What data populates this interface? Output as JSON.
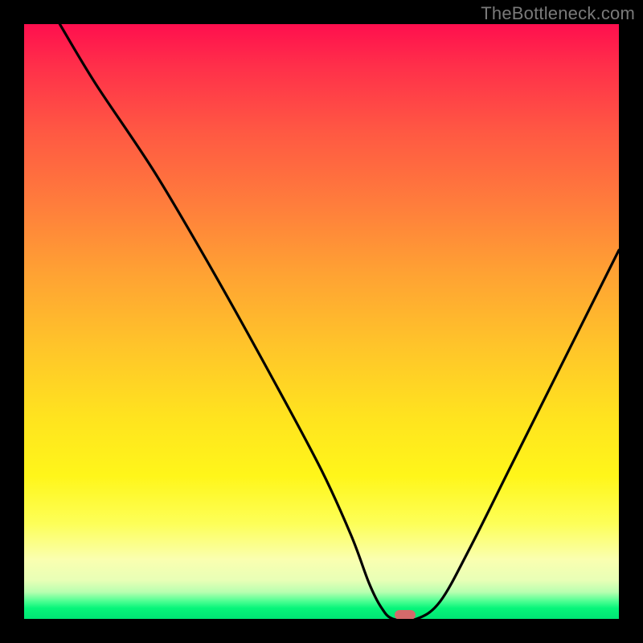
{
  "attribution": {
    "watermark_text": "TheBottleneck.com"
  },
  "chart_data": {
    "type": "line",
    "title": "",
    "xlabel": "",
    "ylabel": "",
    "xlim": [
      0,
      100
    ],
    "ylim": [
      0,
      100
    ],
    "grid": false,
    "legend": false,
    "series": [
      {
        "name": "bottleneck-curve",
        "x": [
          6,
          12,
          22,
          32,
          42,
          50,
          55,
          58,
          60,
          62,
          66,
          70,
          75,
          82,
          90,
          100
        ],
        "y": [
          100,
          90,
          75,
          58,
          40,
          25,
          14,
          6,
          2,
          0,
          0,
          3,
          12,
          26,
          42,
          62
        ]
      }
    ],
    "marker": {
      "name": "optimal-point",
      "x": 64,
      "y": 0,
      "color": "#d46a6a"
    },
    "background_gradient": {
      "top": "#ff0f4e",
      "mid_upper": "#ff7c3c",
      "mid": "#ffe31f",
      "mid_lower": "#faffb0",
      "bottom": "#00e574"
    }
  }
}
